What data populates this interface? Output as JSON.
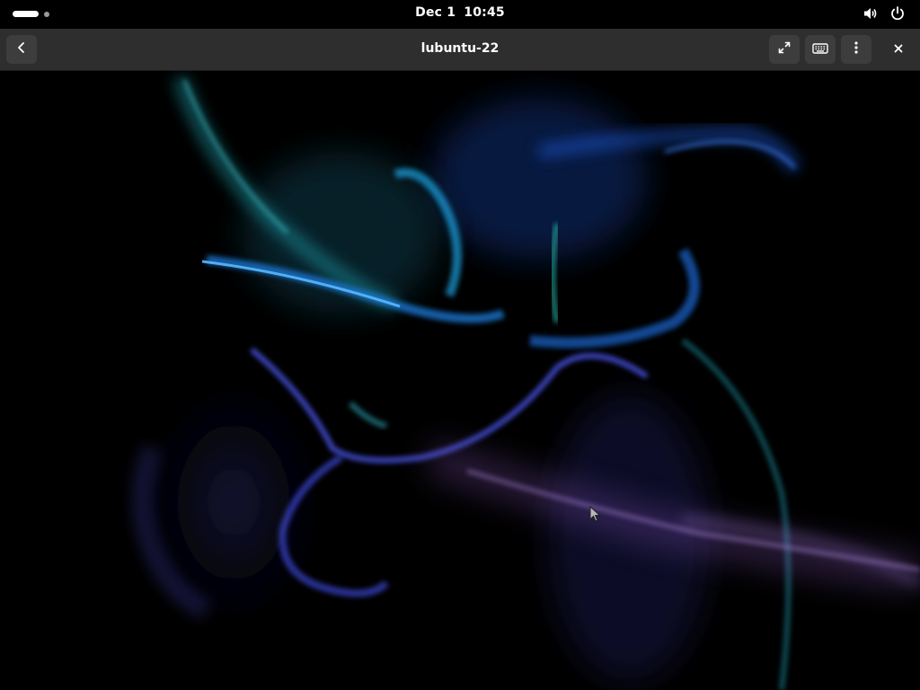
{
  "topbar": {
    "date": "Dec 1",
    "time": "10:45",
    "icons": [
      "volume-icon",
      "power-icon"
    ]
  },
  "headerbar": {
    "title": "lubuntu-22",
    "buttons": [
      "back-button",
      "fullscreen-button",
      "keyboard-button",
      "menu-button",
      "close-button"
    ]
  },
  "display": {
    "content": "lubuntu-22 desktop wallpaper",
    "accent_colors": [
      "#1e8fd8",
      "#3a4fd0",
      "#1fa6a6",
      "#9a6cc8"
    ]
  }
}
